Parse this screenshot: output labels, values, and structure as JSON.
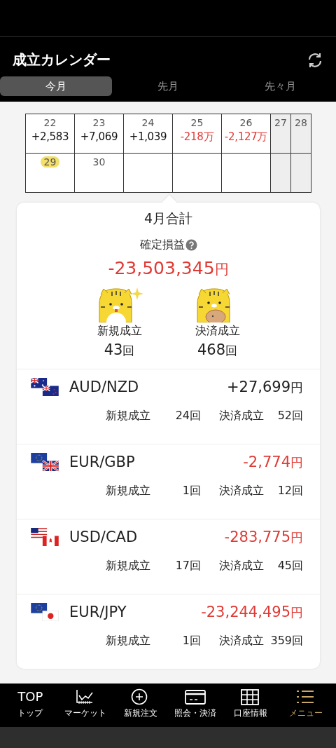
{
  "header": {
    "title": "成立カレンダー",
    "tabs": [
      {
        "label": "今月",
        "selected": true
      },
      {
        "label": "先月",
        "selected": false
      },
      {
        "label": "先々月",
        "selected": false
      }
    ]
  },
  "calendar": {
    "rows": [
      [
        {
          "day": "22",
          "value": "+2,583",
          "loss": false,
          "weekend": false,
          "today": false
        },
        {
          "day": "23",
          "value": "+7,069",
          "loss": false,
          "weekend": false,
          "today": false
        },
        {
          "day": "24",
          "value": "+1,039",
          "loss": false,
          "weekend": false,
          "today": false
        },
        {
          "day": "25",
          "value": "-218万",
          "loss": true,
          "weekend": false,
          "today": false
        },
        {
          "day": "26",
          "value": "-2,127万",
          "loss": true,
          "weekend": false,
          "today": false
        },
        {
          "day": "27",
          "weekend": true,
          "today": false
        },
        {
          "day": "28",
          "weekend": true,
          "today": false
        }
      ],
      [
        {
          "day": "29",
          "weekend": false,
          "today": true
        },
        {
          "day": "30",
          "weekend": false,
          "today": false
        },
        {
          "weekend": false
        },
        {
          "weekend": false
        },
        {
          "weekend": false
        },
        {
          "weekend": true
        },
        {
          "weekend": true
        }
      ]
    ]
  },
  "summary": {
    "title": "4月合計",
    "label": "確定損益",
    "amount": "-23,503,345",
    "unit": "円",
    "loss": true,
    "stats": [
      {
        "kind": "sparkle",
        "label": "新規成立",
        "count": "43",
        "unit": "回"
      },
      {
        "kind": "piggy",
        "label": "決済成立",
        "count": "468",
        "unit": "回"
      }
    ]
  },
  "pairs": [
    {
      "flags": [
        {
          "kind": "au"
        },
        {
          "kind": "nz"
        }
      ],
      "pair": "AUD/NZD",
      "pnl": "+27,699",
      "unit": "円",
      "loss": false,
      "new_label": "新規成立",
      "new_count": "24回",
      "settle_label": "決済成立",
      "settle_count": "52回"
    },
    {
      "flags": [
        {
          "kind": "eu"
        },
        {
          "kind": "gb"
        }
      ],
      "pair": "EUR/GBP",
      "pnl": "-2,774",
      "unit": "円",
      "loss": true,
      "new_label": "新規成立",
      "new_count": "1回",
      "settle_label": "決済成立",
      "settle_count": "12回"
    },
    {
      "flags": [
        {
          "kind": "us"
        },
        {
          "kind": "ca"
        }
      ],
      "pair": "USD/CAD",
      "pnl": "-283,775",
      "unit": "円",
      "loss": true,
      "new_label": "新規成立",
      "new_count": "17回",
      "settle_label": "決済成立",
      "settle_count": "45回"
    },
    {
      "flags": [
        {
          "kind": "eu"
        },
        {
          "kind": "jp"
        }
      ],
      "pair": "EUR/JPY",
      "pnl": "-23,244,495",
      "unit": "円",
      "loss": true,
      "new_label": "新規成立",
      "new_count": "1回",
      "settle_label": "決済成立",
      "settle_count": "359回"
    }
  ],
  "nav": [
    {
      "kind": "top",
      "top_text": "TOP",
      "label": "トップ",
      "selected": false
    },
    {
      "kind": "chart",
      "label": "マーケット",
      "selected": false
    },
    {
      "kind": "plus",
      "label": "新規注文",
      "selected": false
    },
    {
      "kind": "card",
      "label": "照会・決済",
      "selected": false
    },
    {
      "kind": "grid",
      "label": "口座情報",
      "selected": false
    },
    {
      "kind": "list",
      "label": "メニュー",
      "selected": true
    }
  ]
}
